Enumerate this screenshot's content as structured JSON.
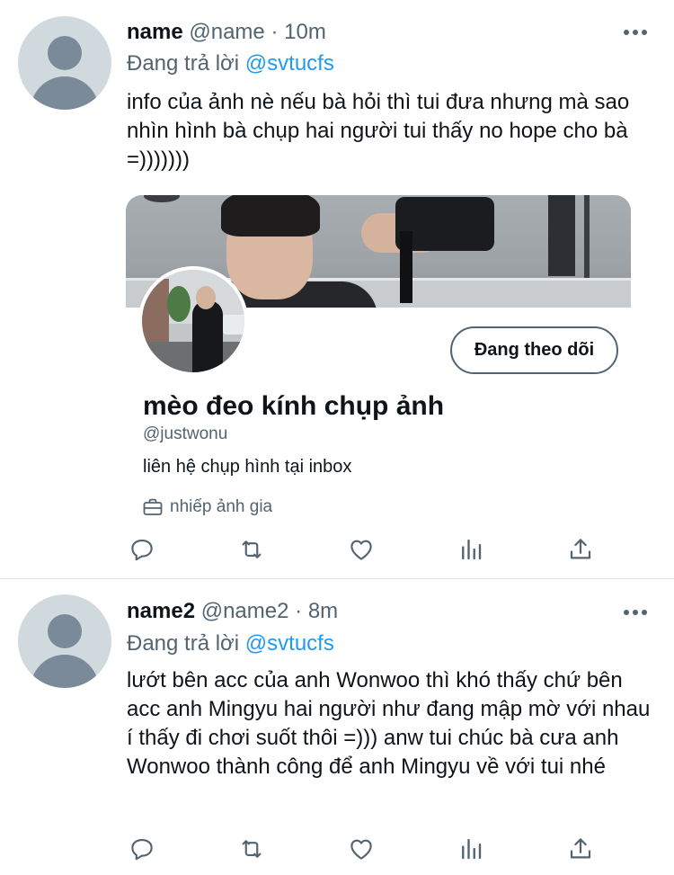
{
  "tweets": [
    {
      "username": "name",
      "handle": "@name",
      "separator": "·",
      "time": "10m",
      "reply_prefix": "Đang trả lời",
      "reply_to": "@svtucfs",
      "text": "info của ảnh nè nếu bà hỏi thì tui đưa nhưng mà sao nhìn hình bà chụp hai người tui thấy no hope cho bà =)))))))",
      "card": {
        "follow_label": "Đang theo dõi",
        "display_name": "mèo đeo kính chụp ảnh",
        "handle": "@justwonu",
        "bio": "liên hệ chụp hình tại inbox",
        "profession": "nhiếp ảnh gia"
      }
    },
    {
      "username": "name2",
      "handle": "@name2",
      "separator": "·",
      "time": "8m",
      "reply_prefix": "Đang trả lời",
      "reply_to": "@svtucfs",
      "text": "lướt bên acc của anh Wonwoo thì khó thấy chứ bên acc anh Mingyu hai người như đang mập mờ với nhau í thấy đi chơi suốt thôi =))) anw tui chúc bà cưa anh Wonwoo thành công để anh Mingyu về với tui nhé"
    }
  ],
  "icons": {
    "more": "more-dots-icon",
    "reply": "reply-icon",
    "retweet": "retweet-icon",
    "like": "like-heart-icon",
    "analytics": "analytics-icon",
    "share": "share-icon",
    "profession": "briefcase-icon"
  },
  "colors": {
    "link": "#1d9bf0",
    "secondary_text": "#536471",
    "primary_text": "#0f1419",
    "divider": "#dfe3e6"
  }
}
